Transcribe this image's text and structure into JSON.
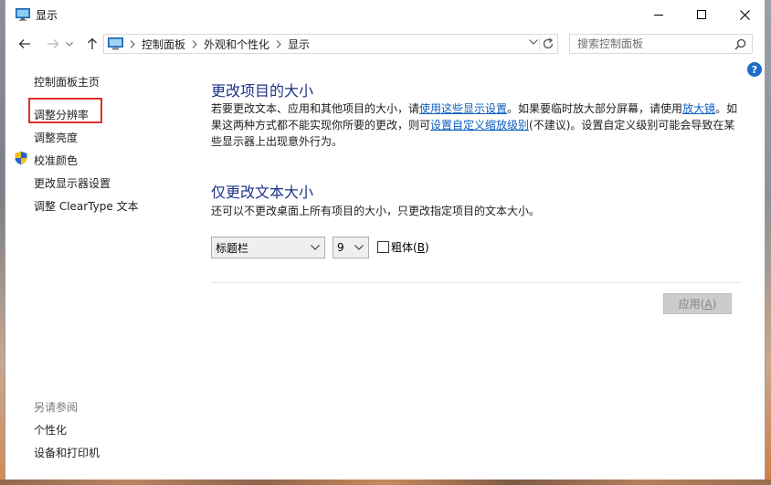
{
  "window": {
    "title": "显示"
  },
  "address": {
    "crumbs": [
      "控制面板",
      "外观和个性化",
      "显示"
    ]
  },
  "search": {
    "placeholder": "搜索控制面板"
  },
  "help": {
    "label": "?"
  },
  "sidebar": {
    "home": "控制面板主页",
    "items": [
      "调整分辨率",
      "调整亮度",
      "校准颜色",
      "更改显示器设置",
      "调整 ClearType 文本"
    ],
    "see_also_title": "另请参阅",
    "see_also": [
      "个性化",
      "设备和打印机"
    ]
  },
  "main": {
    "heading1": "更改项目的大小",
    "para": {
      "t1": "若要更改文本、应用和其他项目的大小，请",
      "link1": "使用这些显示设置",
      "t2": "。如果要临时放大部分屏幕，请使用",
      "link2": "放大镜",
      "t3": "。如果这两种方式都不能实现你所要的更改，则可",
      "link3": "设置自定义缩放级别",
      "t4": "(不建议)。设置自定义级别可能会导致在某些显示器上出现意外行为。"
    },
    "heading2": "仅更改文本大小",
    "subtext": "还可以不更改桌面上所有项目的大小，只更改指定项目的文本大小。",
    "item_select": "标题栏",
    "size_select": "9",
    "bold_label": "粗体",
    "bold_accel": "B",
    "bold_checked": false,
    "apply_label": "应用",
    "apply_accel": "A"
  },
  "colors": {
    "heading": "#1e3287",
    "link": "#0c5fbf",
    "highlight": "#e0312b"
  }
}
